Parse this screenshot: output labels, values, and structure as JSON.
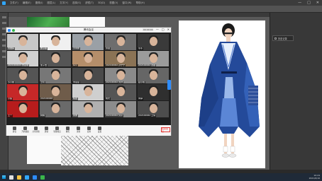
{
  "taskbar": {
    "time": "10:24",
    "date": "2021/6/16"
  },
  "ps": {
    "menu": [
      "文件(F)",
      "编辑(E)",
      "图像(I)",
      "图层(L)",
      "文字(Y)",
      "选择(S)",
      "滤镜(T)",
      "3D(D)",
      "视图(V)",
      "窗口(W)",
      "帮助(H)"
    ],
    "window_controls": [
      "—",
      "□",
      "✕"
    ],
    "panel_label": "历史记录"
  },
  "meeting": {
    "title": "腾讯会议",
    "recording": "00:00:00",
    "leave_label": "结束会议",
    "participants": [
      {
        "name": "刘雅婷",
        "bg": "#c8c8c8"
      },
      {
        "name": "朱小丽",
        "bg": "#f0f0f0"
      },
      {
        "name": "大司命",
        "bg": "#9aa0a6"
      },
      {
        "name": "许诺",
        "bg": "#6e6e6e"
      },
      {
        "name": "冬冬",
        "bg": "#3a3a3a"
      },
      {
        "name": "2021000623 朱嘉琪",
        "bg": "#d0d0d0"
      },
      {
        "name": "吴子怡",
        "bg": "#555555"
      },
      {
        "name": "Gcc",
        "bg": "#b58e6a"
      },
      {
        "name": "202100062 孙宁宁",
        "bg": "#8b7355"
      },
      {
        "name": "202100062 张越",
        "bg": "#9b9b9b"
      },
      {
        "name": "苏小娟",
        "bg": "#555"
      },
      {
        "name": "王晓",
        "bg": "#777"
      },
      {
        "name": "李思思",
        "bg": "#4a4a4a"
      },
      {
        "name": "202100062 刘洋",
        "bg": "#8a8a8a"
      },
      {
        "name": "赵小雨",
        "bg": "#666"
      },
      {
        "name": "小鱼",
        "bg": "#c62828"
      },
      {
        "name": "202100068",
        "bg": "#6f5c4a"
      },
      {
        "name": "陈晨",
        "bg": "#cfcfcf"
      },
      {
        "name": "杨光",
        "bg": "#555"
      },
      {
        "name": "黄静",
        "bg": "#2f2f2f"
      },
      {
        "name": "王一",
        "bg": "#b71c1c"
      },
      {
        "name": "林俏",
        "bg": "#6a6a6a"
      },
      {
        "name": "周末",
        "bg": "#b0b0b0"
      },
      {
        "name": "202100062 何平",
        "bg": "#8c8c8c"
      },
      {
        "name": "202100062 王倩",
        "bg": "#4d4d4d"
      }
    ],
    "toolbar": [
      {
        "label": "静音",
        "icon": "mic-icon"
      },
      {
        "label": "开启视频",
        "icon": "camera-icon"
      },
      {
        "label": "共享屏幕",
        "icon": "share-screen-icon"
      },
      {
        "label": "邀请",
        "icon": "invite-icon"
      },
      {
        "label": "管理成员",
        "icon": "members-icon"
      },
      {
        "label": "聊天",
        "icon": "chat-icon"
      },
      {
        "label": "录制",
        "icon": "record-icon"
      },
      {
        "label": "应用",
        "icon": "apps-icon"
      },
      {
        "label": "设置",
        "icon": "settings-icon"
      }
    ]
  }
}
